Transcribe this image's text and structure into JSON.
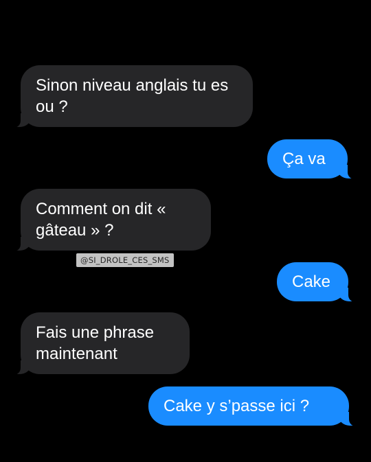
{
  "conversation": {
    "messages": [
      {
        "direction": "received",
        "text": "Sinon niveau anglais tu es ou ?"
      },
      {
        "direction": "sent",
        "text": "Ça va"
      },
      {
        "direction": "received",
        "text": "Comment on dit « gâteau » ?"
      },
      {
        "direction": "sent",
        "text": "Cake"
      },
      {
        "direction": "received",
        "text": "Fais une phrase maintenant"
      },
      {
        "direction": "sent",
        "text": "Cake y s’passe ici ?"
      }
    ]
  },
  "watermark": {
    "text": "@SI_DROLE_CES_SMS"
  },
  "colors": {
    "background": "#000000",
    "received_bubble": "#262628",
    "sent_bubble": "#1a8cff",
    "text": "#ffffff"
  }
}
